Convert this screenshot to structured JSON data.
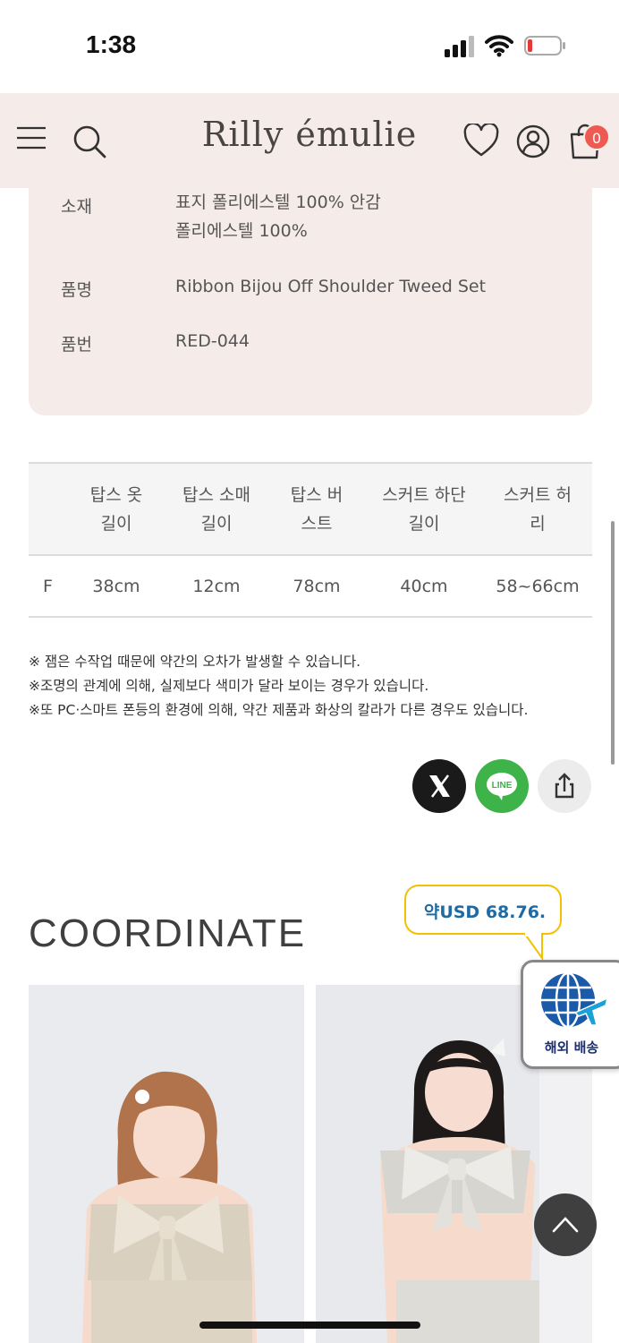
{
  "status_bar": {
    "time": "1:38"
  },
  "header": {
    "logo": "Rilly émulie",
    "cart_count": "0"
  },
  "info": {
    "material_label": "소재",
    "material_value_line1": "표지 폴리에스텔 100% 안감",
    "material_value_line2": "폴리에스텔 100%",
    "name_label": "품명",
    "name_value": "Ribbon Bijou Off Shoulder Tweed Set",
    "number_label": "품번",
    "number_value": "RED-044"
  },
  "size_table": {
    "headers": [
      {
        "line1": "탑스 옷",
        "line2": "길이"
      },
      {
        "line1": "탑스 소매",
        "line2": "길이"
      },
      {
        "line1": "탑스 버",
        "line2": "스트"
      },
      {
        "line1": "스커트 하단",
        "line2": "길이"
      },
      {
        "line1": "스커트 허",
        "line2": "리"
      }
    ],
    "rows": [
      {
        "size": "F",
        "cells": [
          "38cm",
          "12cm",
          "78cm",
          "40cm",
          "58~66cm"
        ]
      }
    ]
  },
  "notes": [
    "※ 잼은 수작업 때문에 약간의 오차가 발생할 수 있습니다.",
    "※조명의 관계에 의해, 실제보다 색미가 달라 보이는 경우가 있습니다.",
    "※또 PC·스마트 폰등의 환경에 의해, 약간 제품과 화상의 칼라가 다른 경우도 있습니다."
  ],
  "share": {
    "line_label": "LINE"
  },
  "coordinate": {
    "title": "COORDINATE"
  },
  "price_bubble": {
    "text": "약USD 68.76."
  },
  "shipping": {
    "label": "해외 배송"
  },
  "colors": {
    "header_bg": "#f5ebe8",
    "price_text": "#1d6aa5",
    "bubble_border": "#f2c200",
    "line_green": "#3db349",
    "badge_red": "#ee5a52"
  }
}
